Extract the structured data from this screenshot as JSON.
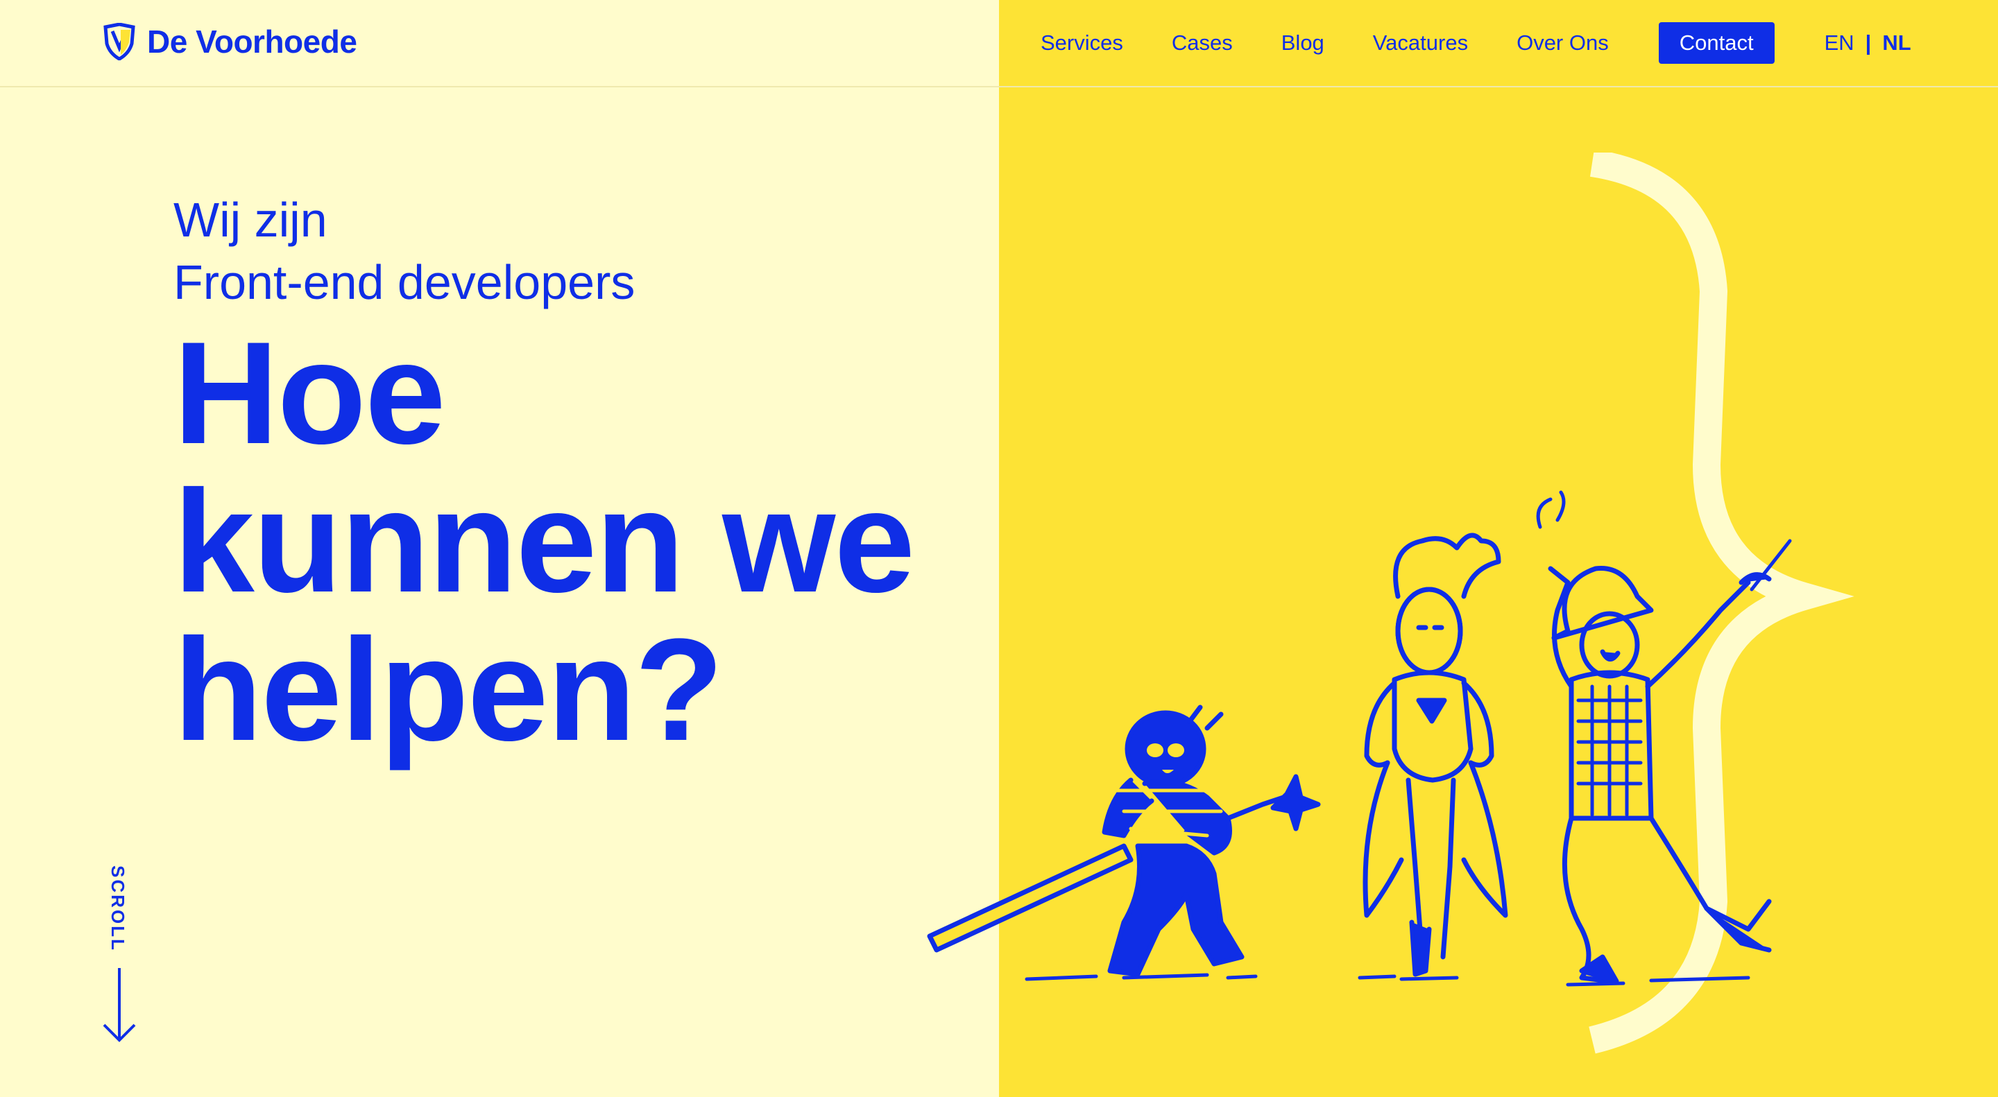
{
  "brand": {
    "name": "De Voorhoede",
    "primary_color": "#0f2ee6",
    "left_bg": "#fffccc",
    "right_bg": "#fde335",
    "logo_icon": "shield-logo-icon"
  },
  "nav": {
    "items": [
      {
        "label": "Services"
      },
      {
        "label": "Cases"
      },
      {
        "label": "Blog"
      },
      {
        "label": "Vacatures"
      },
      {
        "label": "Over Ons"
      }
    ],
    "contact_label": "Contact",
    "lang": {
      "en": "EN",
      "separator": "|",
      "nl": "NL",
      "active": "NL"
    }
  },
  "hero": {
    "intro_line1": "Wij zijn",
    "intro_line2": "Front-end developers",
    "headline_lines": [
      "Hoe",
      "kunnen we",
      "helpen?"
    ]
  },
  "scroll": {
    "label": "SCROLL",
    "icon": "arrow-down-icon"
  },
  "illustration": {
    "characters": [
      "ninja-character",
      "superhero-character",
      "cowboy-character"
    ],
    "decoration": "curly-brace"
  }
}
